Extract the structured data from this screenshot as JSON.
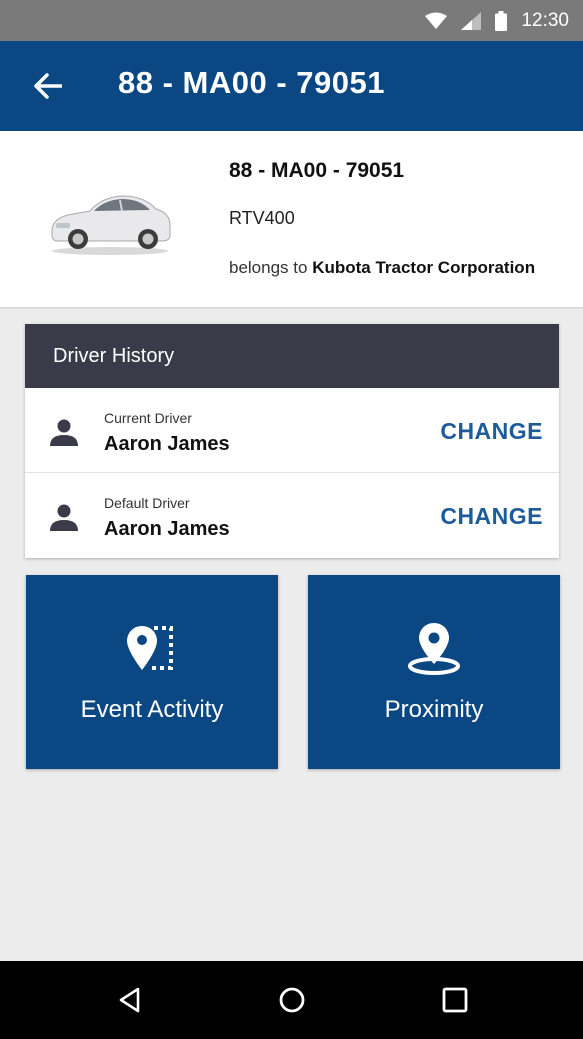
{
  "status_bar": {
    "time": "12:30",
    "icons": [
      "wifi-icon",
      "signal-icon",
      "battery-icon"
    ]
  },
  "app_bar": {
    "title": "88 - MA00 - 79051",
    "back_icon": "arrow-left-icon"
  },
  "vehicle": {
    "plate": "88 - MA00 - 79051",
    "model": "RTV400",
    "owner_prefix": "belongs to",
    "owner_name": "Kubota Tractor Corporation",
    "image": "car-image"
  },
  "driver_history": {
    "title": "Driver History",
    "rows": [
      {
        "role": "Current Driver",
        "name": "Aaron James",
        "action": "CHANGE",
        "icon": "person-icon"
      },
      {
        "role": "Default Driver",
        "name": "Aaron James",
        "action": "CHANGE",
        "icon": "person-icon"
      }
    ]
  },
  "tiles": [
    {
      "label": "Event Activity",
      "icon": "event-activity-icon"
    },
    {
      "label": "Proximity",
      "icon": "proximity-pin-icon"
    }
  ],
  "nav_bar": {
    "icons": [
      "back-triangle-icon",
      "home-circle-icon",
      "recents-square-icon"
    ]
  },
  "colors": {
    "primary": "#0b4883",
    "header_dark": "#3b3a49",
    "accent_text": "#1d5b9b",
    "status_bar": "#7a7a7a",
    "background": "#ececec"
  }
}
